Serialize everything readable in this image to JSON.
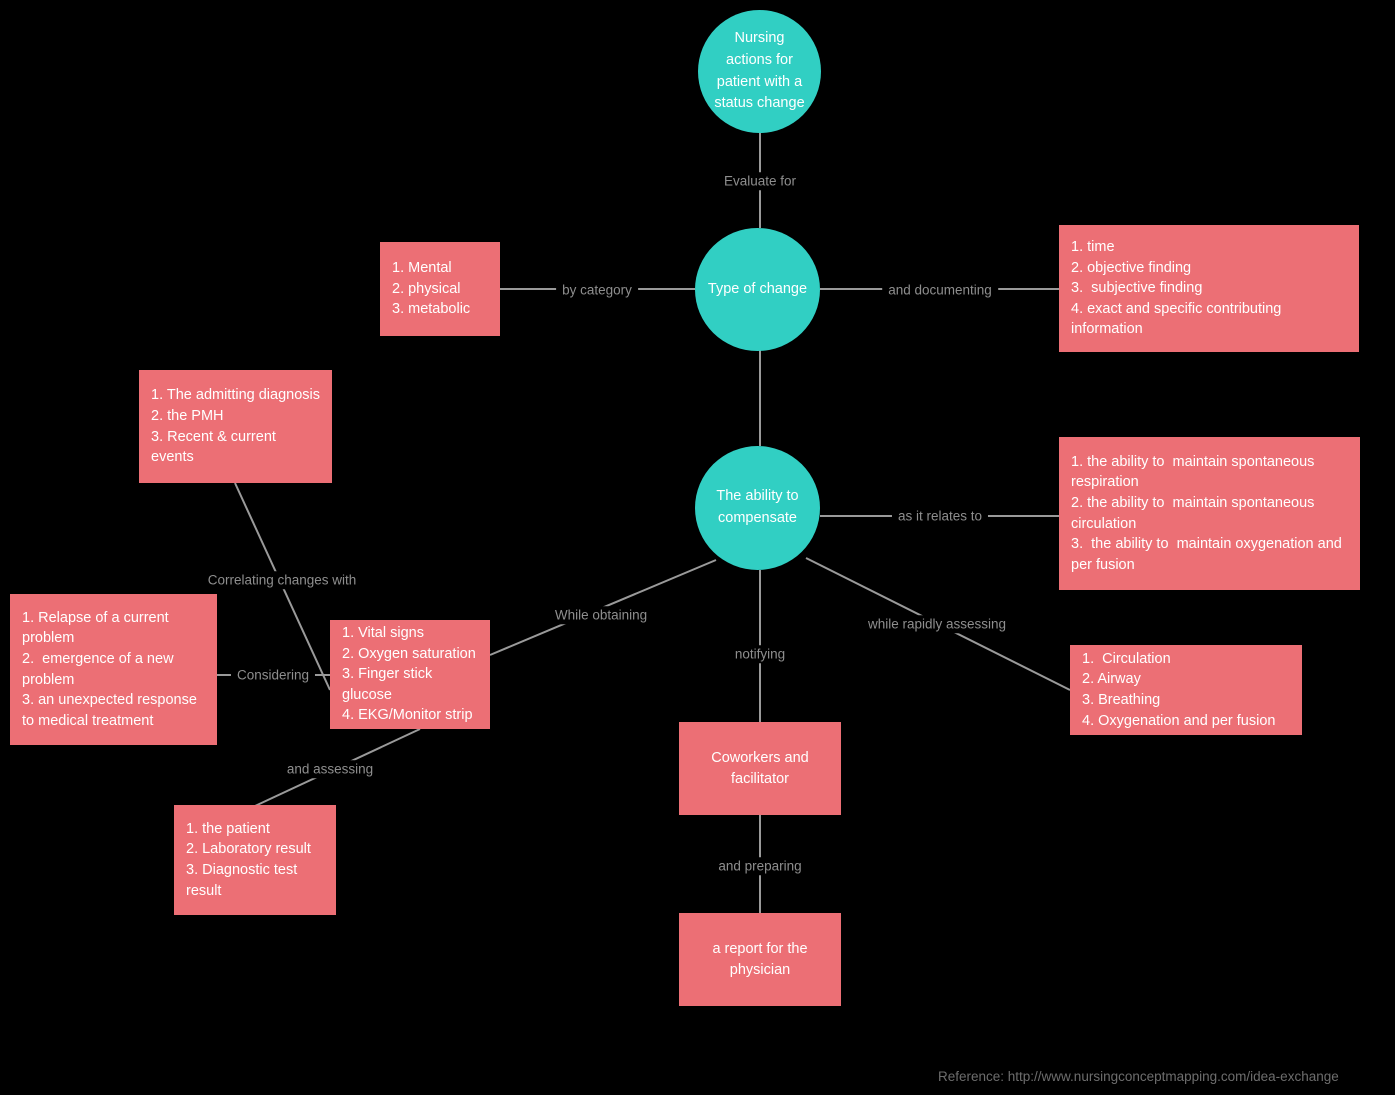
{
  "diagram": {
    "title": "Nursing actions for patient with a status change concept map",
    "background_color": "#000000",
    "circle_color": "#31cfc3",
    "box_color": "#ec6f75",
    "edge_color": "#9a9a9a",
    "edge_label_color": "#8e8e8e",
    "node_text_color": "#ffffff"
  },
  "nodes": {
    "root": {
      "label": "Nursing actions for patient with a status change",
      "shape": "circle"
    },
    "type_of_change": {
      "label": "Type of change",
      "shape": "circle"
    },
    "ability_to_compensate": {
      "label": "The ability to compensate",
      "shape": "circle"
    },
    "category_box": {
      "shape": "box",
      "lines": [
        "1. Mental",
        "2. physical",
        "3. metabolic"
      ]
    },
    "documenting_box": {
      "shape": "box",
      "lines": [
        "1. time",
        "2. objective finding",
        "3.  subjective finding",
        "4. exact and specific contributing information"
      ]
    },
    "history_box": {
      "shape": "box",
      "lines": [
        "1. The admitting diagnosis",
        "2. the PMH",
        "3. Recent & current events"
      ]
    },
    "relates_to_box": {
      "shape": "box",
      "lines": [
        "1. the ability to  maintain spontaneous respiration",
        "2. the ability to  maintain spontaneous circulation",
        "3.  the ability to  maintain oxygenation and per fusion"
      ]
    },
    "considering_box": {
      "shape": "box",
      "lines": [
        "1. Relapse of a current problem",
        "2.  emergence of a new problem",
        "3. an unexpected response to medical treatment"
      ]
    },
    "obtaining_box": {
      "shape": "box",
      "lines": [
        "1. Vital signs",
        "2. Oxygen saturation",
        "3. Finger stick glucose",
        "4. EKG/Monitor strip"
      ]
    },
    "assessing_box": {
      "shape": "box",
      "lines": [
        "1. the patient",
        "2. Laboratory result",
        "3. Diagnostic test result"
      ]
    },
    "rapid_assess_box": {
      "shape": "box",
      "lines": [
        "1.  Circulation",
        "2. Airway",
        "3. Breathing",
        "4. Oxygenation and per fusion"
      ]
    },
    "coworkers_box": {
      "shape": "box",
      "label": "Coworkers and facilitator"
    },
    "report_box": {
      "shape": "box",
      "label": "a report for the physician"
    }
  },
  "edge_labels": {
    "evaluate_for": "Evaluate for",
    "by_category": "by category",
    "and_documenting": "and documenting",
    "correlating_changes_with": "Correlating changes with",
    "as_it_relates_to": "as it relates to",
    "considering": "Considering",
    "while_obtaining": "While obtaining",
    "notifying": "notifying",
    "while_rapidly_assessing": "while rapidly assessing",
    "and_assessing": "and assessing",
    "and_preparing": "and preparing"
  },
  "footer": {
    "reference": "Reference: http://www.nursingconceptmapping.com/idea-exchange"
  }
}
